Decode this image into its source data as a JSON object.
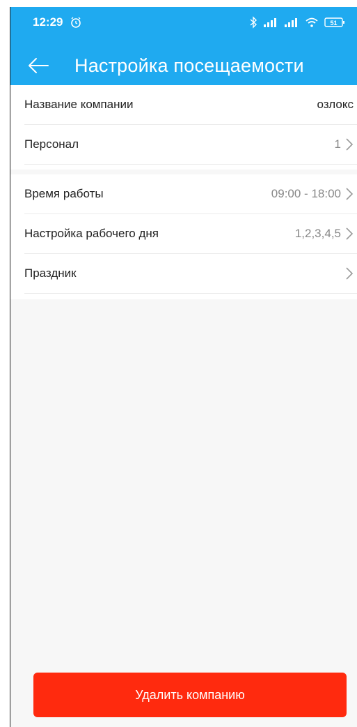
{
  "status_bar": {
    "time": "12:29",
    "battery": "51",
    "icons": [
      "alarm-icon",
      "bluetooth-icon",
      "signal-icon",
      "signal-icon",
      "wifi-icon",
      "battery-icon"
    ]
  },
  "header": {
    "title": "Настройка посещаемости",
    "background": "#1faaf0"
  },
  "settings": {
    "company_name": {
      "label": "Название компании",
      "value": "озлокс"
    },
    "staff": {
      "label": "Персонал",
      "value": "1"
    },
    "work_time": {
      "label": "Время работы",
      "value": "09:00 - 18:00"
    },
    "workday": {
      "label": "Настройка рабочего дня",
      "value": "1,2,3,4,5"
    },
    "holiday": {
      "label": "Праздник",
      "value": ""
    }
  },
  "footer": {
    "delete_label": "Удалить компанию",
    "button_color": "#ff2a0e"
  }
}
